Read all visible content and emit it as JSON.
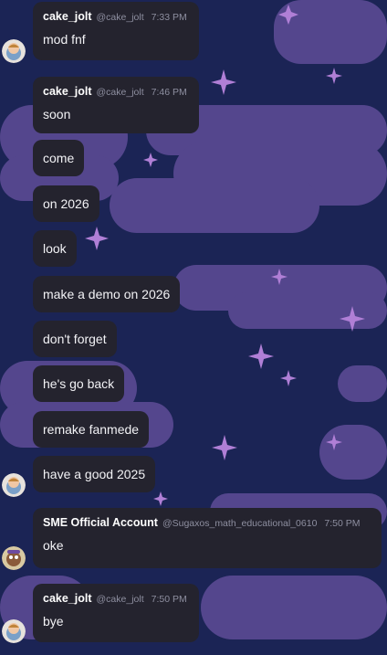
{
  "messages": [
    {
      "type": "head",
      "username": "cake_jolt",
      "handle": "@cake_jolt",
      "time": "7:33 PM",
      "text": "mod fnf"
    },
    {
      "type": "head",
      "username": "cake_jolt",
      "handle": "@cake_jolt",
      "time": "7:46 PM",
      "text": "soon"
    },
    {
      "type": "simple",
      "text": "come"
    },
    {
      "type": "simple",
      "text": "on 2026"
    },
    {
      "type": "simple",
      "text": "look"
    },
    {
      "type": "simple",
      "text": "make a demo on 2026"
    },
    {
      "type": "simple",
      "text": "don't forget"
    },
    {
      "type": "simple",
      "text": "he's go back"
    },
    {
      "type": "simple",
      "text": "remake fanmede"
    },
    {
      "type": "simple",
      "text": "have a good 2025"
    },
    {
      "type": "head",
      "username": "SME Official Account",
      "handle": "@Sugaxos_math_educational_0610",
      "time": "7:50 PM",
      "text": "oke"
    },
    {
      "type": "head",
      "username": "cake_jolt",
      "handle": "@cake_jolt",
      "time": "7:50 PM",
      "text": "bye"
    }
  ],
  "avatars": [
    {
      "user": "cake_jolt",
      "icon": "cake-jolt-avatar-icon"
    },
    {
      "user": "SME Official Account",
      "icon": "sme-avatar-icon"
    }
  ],
  "colors": {
    "background": "#1b2455",
    "cloud": "#5b4a94",
    "star": "#b07fd6",
    "bubble": "#24232e",
    "text": "#f2f2f5",
    "muted": "#8e8fa0"
  }
}
